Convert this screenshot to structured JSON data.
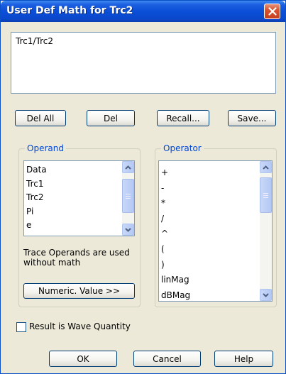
{
  "window": {
    "title": "User Def Math for Trc2"
  },
  "expression": {
    "value": "Trc1/Trc2"
  },
  "buttons": {
    "del_all": "Del All",
    "del": "Del",
    "recall": "Recall...",
    "save": "Save...",
    "numeric_value": "Numeric. Value >>",
    "ok": "OK",
    "cancel": "Cancel",
    "help": "Help"
  },
  "operand": {
    "legend": "Operand",
    "items": [
      "Data",
      "Trc1",
      "Trc2",
      "Pi",
      "e"
    ],
    "note": "Trace Operands are used without math"
  },
  "operator": {
    "legend": "Operator",
    "items": [
      "+",
      "-",
      "*",
      "/",
      "^",
      "(",
      ")",
      "linMag",
      "dBMag"
    ]
  },
  "options": {
    "wave_quantity_label": "Result is Wave Quantity",
    "wave_quantity_checked": false
  },
  "colors": {
    "title_bar": "#0b4fd8",
    "dialog_bg": "#ece9d8",
    "legend_text": "#0046d5",
    "close_button": "#d9532f"
  }
}
